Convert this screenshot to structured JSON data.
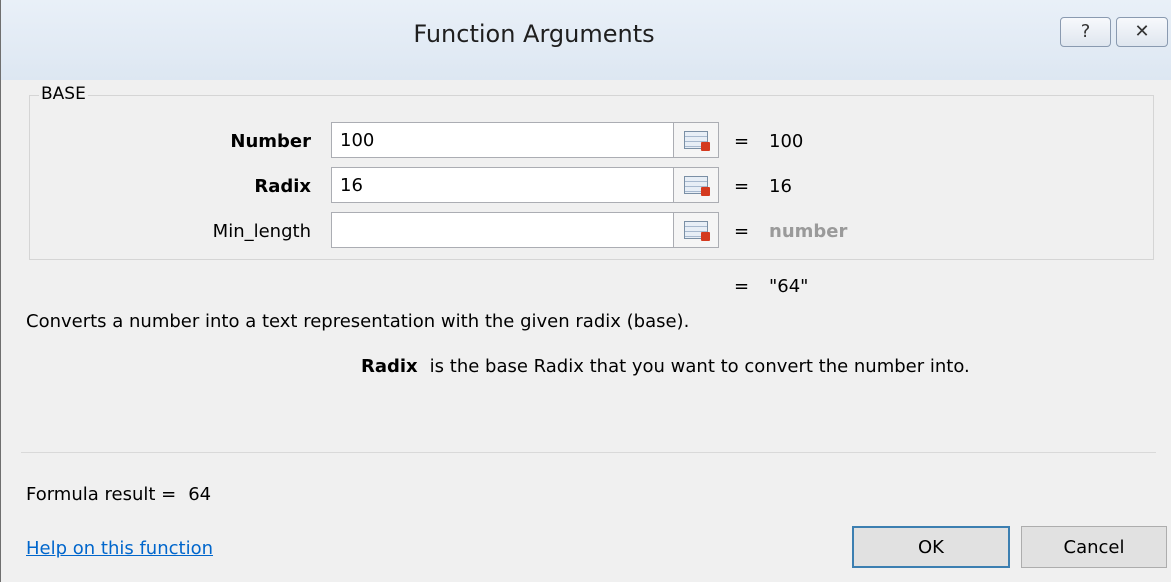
{
  "window": {
    "title": "Function Arguments",
    "help_glyph": "?",
    "close_glyph": "✕"
  },
  "group": {
    "label": "BASE"
  },
  "args": [
    {
      "label": "Number",
      "value": "100",
      "result": "100"
    },
    {
      "label": "Radix",
      "value": "16",
      "result": "16"
    },
    {
      "label": "Min_length",
      "value": "",
      "result": "number"
    }
  ],
  "equals": "=",
  "overall_result": "\"64\"",
  "description": "Converts a number into a text representation with the given radix (base).",
  "arg_description": {
    "name": "Radix",
    "text": "is the base Radix that you want to convert the number into."
  },
  "formula": {
    "label": "Formula result =",
    "value": "64"
  },
  "help_link": "Help on this function",
  "buttons": {
    "ok": "OK",
    "cancel": "Cancel"
  },
  "colors": {
    "link": "#0066cc",
    "placeholder_result": "#9a9a9a",
    "default_button_border": "#3c7fb1"
  }
}
